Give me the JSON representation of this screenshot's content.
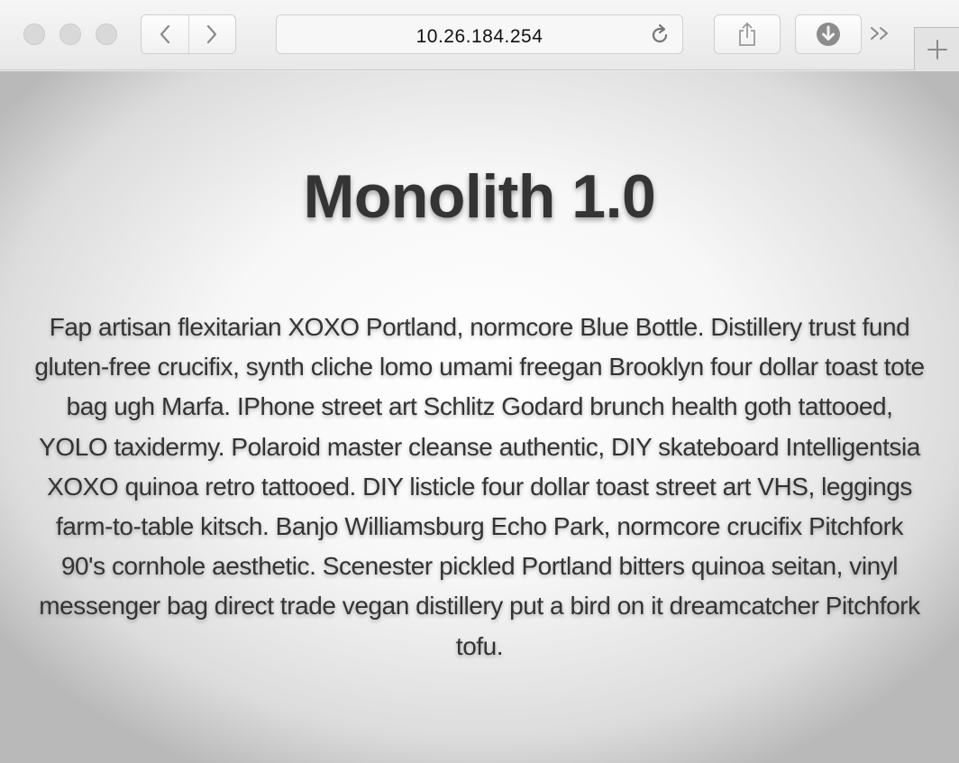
{
  "browser": {
    "address_url": "10.26.184.254",
    "icons": {
      "back": "chevron-left-icon",
      "forward": "chevron-right-icon",
      "reload": "reload-icon",
      "share": "share-icon",
      "download": "download-icon",
      "more": "double-chevron-right-icon",
      "new_tab": "plus-icon"
    }
  },
  "page": {
    "title": "Monolith 1.0",
    "paragraph": "Fap artisan flexitarian XOXO Portland, normcore Blue Bottle. Distillery trust fund gluten-free crucifix, synth cliche lomo umami freegan Brooklyn four dollar toast tote bag ugh Marfa. IPhone street art Schlitz Godard brunch health goth tattooed, YOLO taxidermy. Polaroid master cleanse authentic, DIY skateboard Intelligentsia XOXO quinoa retro tattooed. DIY listicle four dollar toast street art VHS, leggings farm-to-table kitsch. Banjo Williamsburg Echo Park, normcore crucifix Pitchfork 90's cornhole aesthetic. Scenester pickled Portland bitters quinoa seitan, vinyl messenger bag direct trade vegan distillery put a bird on it dreamcatcher Pitchfork tofu."
  }
}
